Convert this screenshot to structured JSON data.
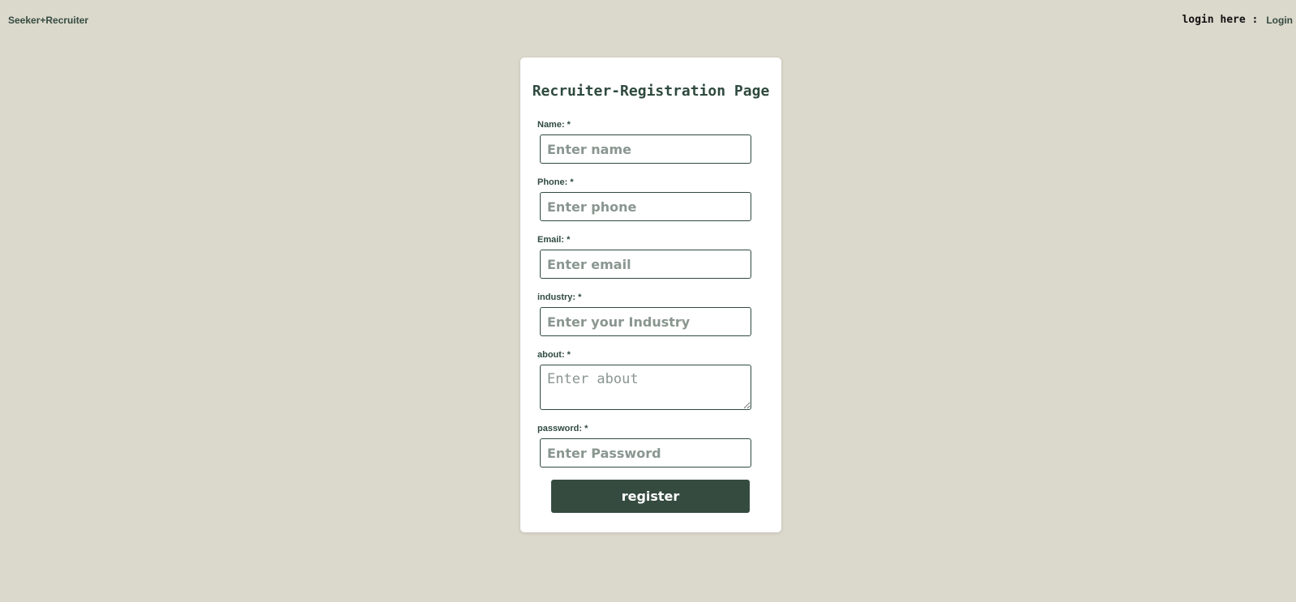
{
  "header": {
    "brand": "Seeker+Recruiter",
    "login_prompt": "login here :",
    "login_link": "Login"
  },
  "form": {
    "title": "Recruiter-Registration Page",
    "fields": {
      "name": {
        "label": "Name: *",
        "placeholder": "Enter name"
      },
      "phone": {
        "label": "Phone: *",
        "placeholder": "Enter phone"
      },
      "email": {
        "label": "Email: *",
        "placeholder": "Enter email"
      },
      "industry": {
        "label": "industry: *",
        "placeholder": "Enter your Industry"
      },
      "about": {
        "label": "about: *",
        "placeholder": "Enter about"
      },
      "password": {
        "label": "password: *",
        "placeholder": "Enter Password"
      }
    },
    "submit_label": "register"
  },
  "colors": {
    "background": "#dbd8cc",
    "accent": "#354b40",
    "card": "#ffffff"
  }
}
